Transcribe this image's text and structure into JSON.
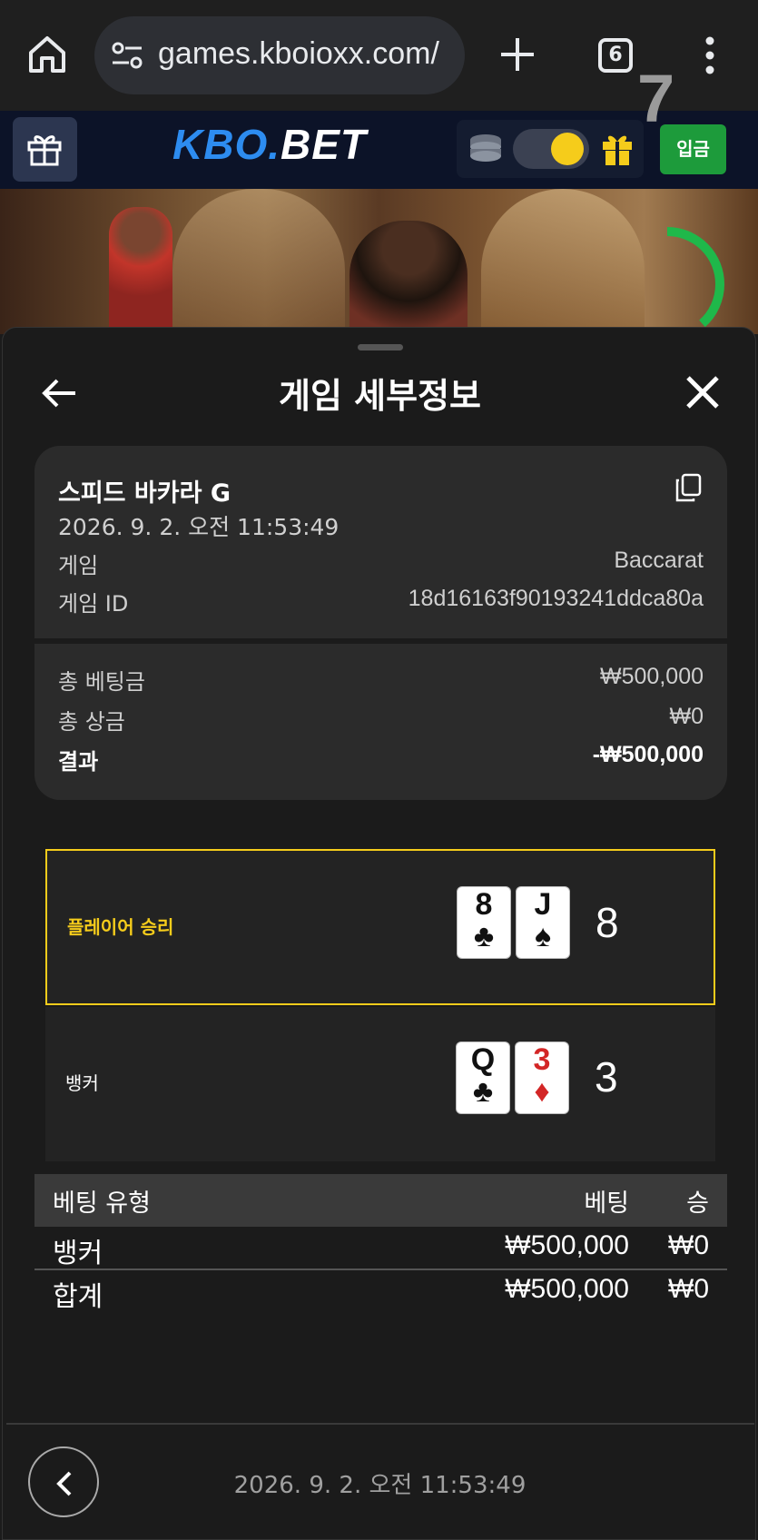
{
  "browser": {
    "url": "games.kboioxx.com/",
    "tab_count": "6"
  },
  "header": {
    "logo_kbo": "KBO",
    "logo_dot": ".",
    "logo_bet": "BET",
    "deposit_label": "입금"
  },
  "video": {
    "timer": "7"
  },
  "sheet": {
    "title": "게임 세부정보",
    "game_name": "스피드 바카라 G",
    "game_time": "2026. 9. 2. 오전 11:53:49",
    "game_label": "게임",
    "game_value": "Baccarat",
    "game_id_label": "게임 ID",
    "game_id_value": "18d16163f90193241ddca80a",
    "total_bet_label": "총 베팅금",
    "total_bet_value": "₩500,000",
    "total_win_label": "총 상금",
    "total_win_value": "₩0",
    "result_label": "결과",
    "result_value": "-₩500,000"
  },
  "outcome": {
    "player": {
      "label": "플레이어 승리",
      "cards": [
        {
          "rank": "8",
          "suit": "♣"
        },
        {
          "rank": "J",
          "suit": "♠"
        }
      ],
      "score": "8"
    },
    "banker": {
      "label": "뱅커",
      "cards": [
        {
          "rank": "Q",
          "suit": "♣"
        },
        {
          "rank": "3",
          "suit": "♦"
        }
      ],
      "score": "3"
    }
  },
  "bet_table": {
    "headers": [
      "베팅 유형",
      "베팅",
      "승"
    ],
    "rows": [
      [
        "뱅커",
        "₩500,000",
        "₩0"
      ],
      [
        "합계",
        "₩500,000",
        "₩0"
      ]
    ]
  },
  "footer": {
    "time": "2026. 9. 2. 오전 11:53:49"
  },
  "colors": {
    "accent_yellow": "#f5cc1b",
    "deposit_green": "#1d9b3b",
    "logo_blue": "#2d8cf0",
    "timer_green": "#1fb84a"
  }
}
